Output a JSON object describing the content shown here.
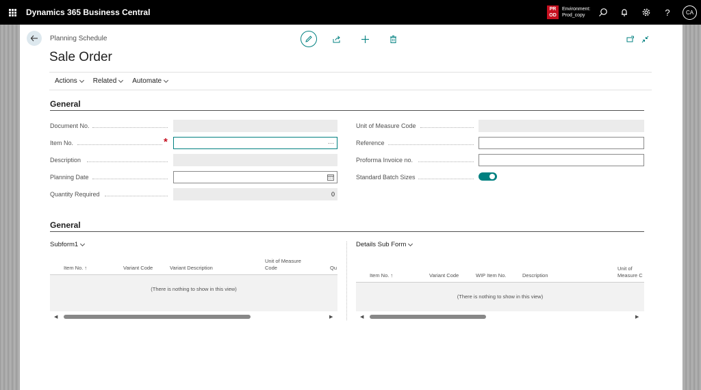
{
  "app": {
    "title": "Dynamics 365 Business Central",
    "environment": {
      "badge": "PR OD",
      "label": "Environment:",
      "name": "Prod_copy"
    },
    "avatar": "CA"
  },
  "header": {
    "breadcrumb": "Planning Schedule",
    "title": "Sale Order"
  },
  "actions": [
    "Actions",
    "Related",
    "Automate"
  ],
  "general": {
    "heading": "General",
    "left_fields": [
      {
        "label": "Document No.",
        "value": ""
      },
      {
        "label": "Item No.",
        "value": "",
        "required": true,
        "lookup": "···"
      },
      {
        "label": "Description",
        "value": ""
      },
      {
        "label": "Planning Date",
        "value": ""
      },
      {
        "label": "Quantity Required",
        "value": "0"
      }
    ],
    "right_fields": [
      {
        "label": "Unit of Measure Code",
        "value": ""
      },
      {
        "label": "Reference",
        "value": ""
      },
      {
        "label": "Proforma Invoice no.",
        "value": ""
      },
      {
        "label": "Standard Batch Sizes",
        "value": "on"
      }
    ]
  },
  "general2": {
    "heading": "General"
  },
  "subform1": {
    "title": "Subform1",
    "columns": [
      "Item No. ↑",
      "Variant Code",
      "Variant Description",
      "Unit of Measure Code",
      "Qu"
    ],
    "empty": "(There is nothing to show in this view)"
  },
  "subform2": {
    "title": "Details Sub Form",
    "columns": [
      "Item No. ↑",
      "Variant Code",
      "WIP Item No.",
      "Description",
      "Unit of Measure C"
    ],
    "empty": "(There is nothing to show in this view)"
  },
  "colors": {
    "accent": "#008080",
    "required": "#c50f1f",
    "topbar": "#000000"
  }
}
